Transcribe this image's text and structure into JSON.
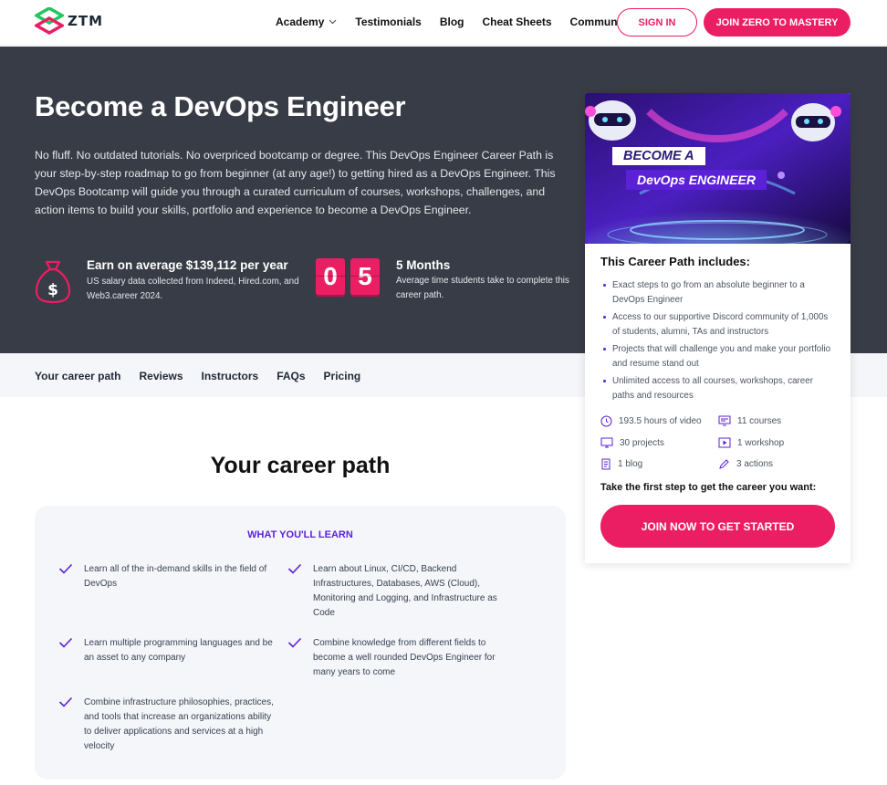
{
  "header": {
    "logo_text": "ZTM",
    "nav": [
      {
        "label": "Academy",
        "has_dropdown": true
      },
      {
        "label": "Testimonials"
      },
      {
        "label": "Blog"
      },
      {
        "label": "Cheat Sheets"
      },
      {
        "label": "Community"
      }
    ],
    "signin_label": "SIGN IN",
    "join_label": "JOIN ZERO TO MASTERY"
  },
  "hero": {
    "title": "Become a DevOps Engineer",
    "description": "No fluff. No outdated tutorials. No overpriced bootcamp or degree. This DevOps Engineer Career Path is your step-by-step roadmap to go from beginner (at any age!) to getting hired as a DevOps Engineer. This DevOps Bootcamp will guide you through a curated curriculum of courses, workshops, challenges, and action items to build your skills, portfolio and experience to become a DevOps Engineer.",
    "salary_title": "Earn on average $139,112 per year",
    "salary_sub": "US salary data collected from Indeed, Hired.com, and Web3.career 2024.",
    "months_digits": [
      "0",
      "5"
    ],
    "months_title": "5 Months",
    "months_sub": "Average time students take to complete this career path."
  },
  "subnav": [
    "Your career path",
    "Reviews",
    "Instructors",
    "FAQs",
    "Pricing"
  ],
  "career_path": {
    "title": "Your career path",
    "learn_heading": "WHAT YOU'LL LEARN",
    "items": [
      "Learn all of the in-demand skills in the field of DevOps",
      "Learn about Linux, CI/CD, Backend Infrastructures, Databases, AWS (Cloud), Monitoring and Logging, and Infrastructure as Code",
      "Learn multiple programming languages and be an asset to any company",
      "Combine knowledge from different fields to become a well rounded DevOps Engineer for many years to come",
      "Combine infrastructure philosophies, practices, and tools that increase an organizations ability to deliver applications and services at a high velocity"
    ]
  },
  "card": {
    "banner_line1": "BECOME A",
    "banner_line2": "DevOps ENGINEER",
    "title": "This Career Path includes:",
    "includes": [
      "Exact steps to go from an absolute beginner to a DevOps Engineer",
      "Access to our supportive Discord community of 1,000s of students, alumni, TAs and instructors",
      "Projects that will challenge you and make your portfolio and resume stand out",
      "Unlimited access to all courses, workshops, career paths and resources"
    ],
    "features": [
      {
        "icon": "clock-icon",
        "label": "193.5 hours of video"
      },
      {
        "icon": "courses-icon",
        "label": "11 courses"
      },
      {
        "icon": "monitor-icon",
        "label": "30 projects"
      },
      {
        "icon": "play-icon",
        "label": "1 workshop"
      },
      {
        "icon": "document-icon",
        "label": "1 blog"
      },
      {
        "icon": "pen-icon",
        "label": "3 actions"
      }
    ],
    "cta_text": "Take the first step to get the career you want:",
    "cta_button": "JOIN NOW TO GET STARTED"
  },
  "colors": {
    "accent_pink": "#ec1e63",
    "accent_purple": "#5b21d6",
    "hero_bg": "#383c46",
    "logo_green": "#22c55e"
  }
}
